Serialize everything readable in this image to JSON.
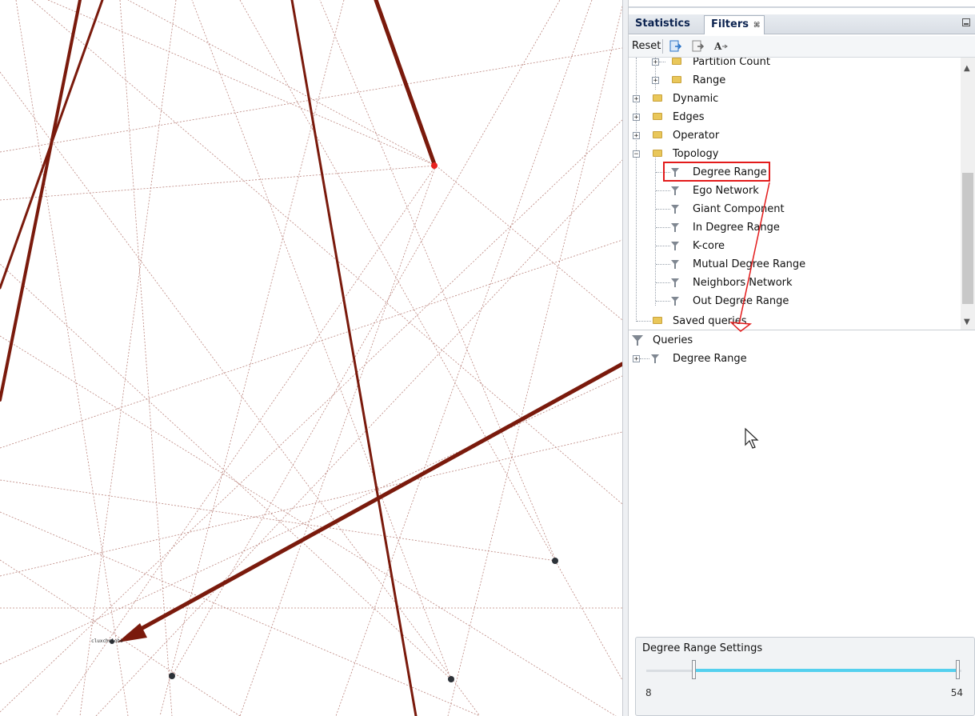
{
  "tabs": [
    {
      "label": "Statistics",
      "active": false
    },
    {
      "label": "Filters",
      "active": true
    }
  ],
  "tab_close_glyph": "⌘",
  "toolbar": {
    "reset_label": "Reset",
    "icons": [
      "export-filter-icon",
      "export-query-icon",
      "rename-icon"
    ]
  },
  "library_tree": [
    {
      "label": "Partition Count",
      "icon": "folder",
      "level": 1,
      "expanded": false
    },
    {
      "label": "Range",
      "icon": "folder",
      "level": 1,
      "expanded": false
    },
    {
      "label": "Dynamic",
      "icon": "folder",
      "level": 0,
      "expanded": false
    },
    {
      "label": "Edges",
      "icon": "folder",
      "level": 0,
      "expanded": false
    },
    {
      "label": "Operator",
      "icon": "folder",
      "level": 0,
      "expanded": false
    },
    {
      "label": "Topology",
      "icon": "folder",
      "level": 0,
      "expanded": true
    },
    {
      "label": "Degree Range",
      "icon": "filter",
      "level": 1,
      "highlighted": true
    },
    {
      "label": "Ego Network",
      "icon": "filter",
      "level": 1
    },
    {
      "label": "Giant Component",
      "icon": "filter",
      "level": 1
    },
    {
      "label": "In Degree Range",
      "icon": "filter",
      "level": 1
    },
    {
      "label": "K-core",
      "icon": "filter",
      "level": 1
    },
    {
      "label": "Mutual Degree Range",
      "icon": "filter",
      "level": 1
    },
    {
      "label": "Neighbors Network",
      "icon": "filter",
      "level": 1
    },
    {
      "label": "Out Degree Range",
      "icon": "filter",
      "level": 1
    },
    {
      "label": "Saved queries",
      "icon": "folder",
      "level": 0
    }
  ],
  "queries": {
    "root_label": "Queries",
    "items": [
      {
        "label": "Degree Range",
        "expanded": false
      }
    ]
  },
  "settings": {
    "title": "Degree Range Settings",
    "min": 8,
    "max": 54,
    "low": 8,
    "high": 54
  },
  "graph": {
    "node_label": "cluxcholobe",
    "edge_color": "#7a1a0c",
    "highlight_node_color": "#e8231f",
    "annotation_color": "#e31b1b"
  }
}
